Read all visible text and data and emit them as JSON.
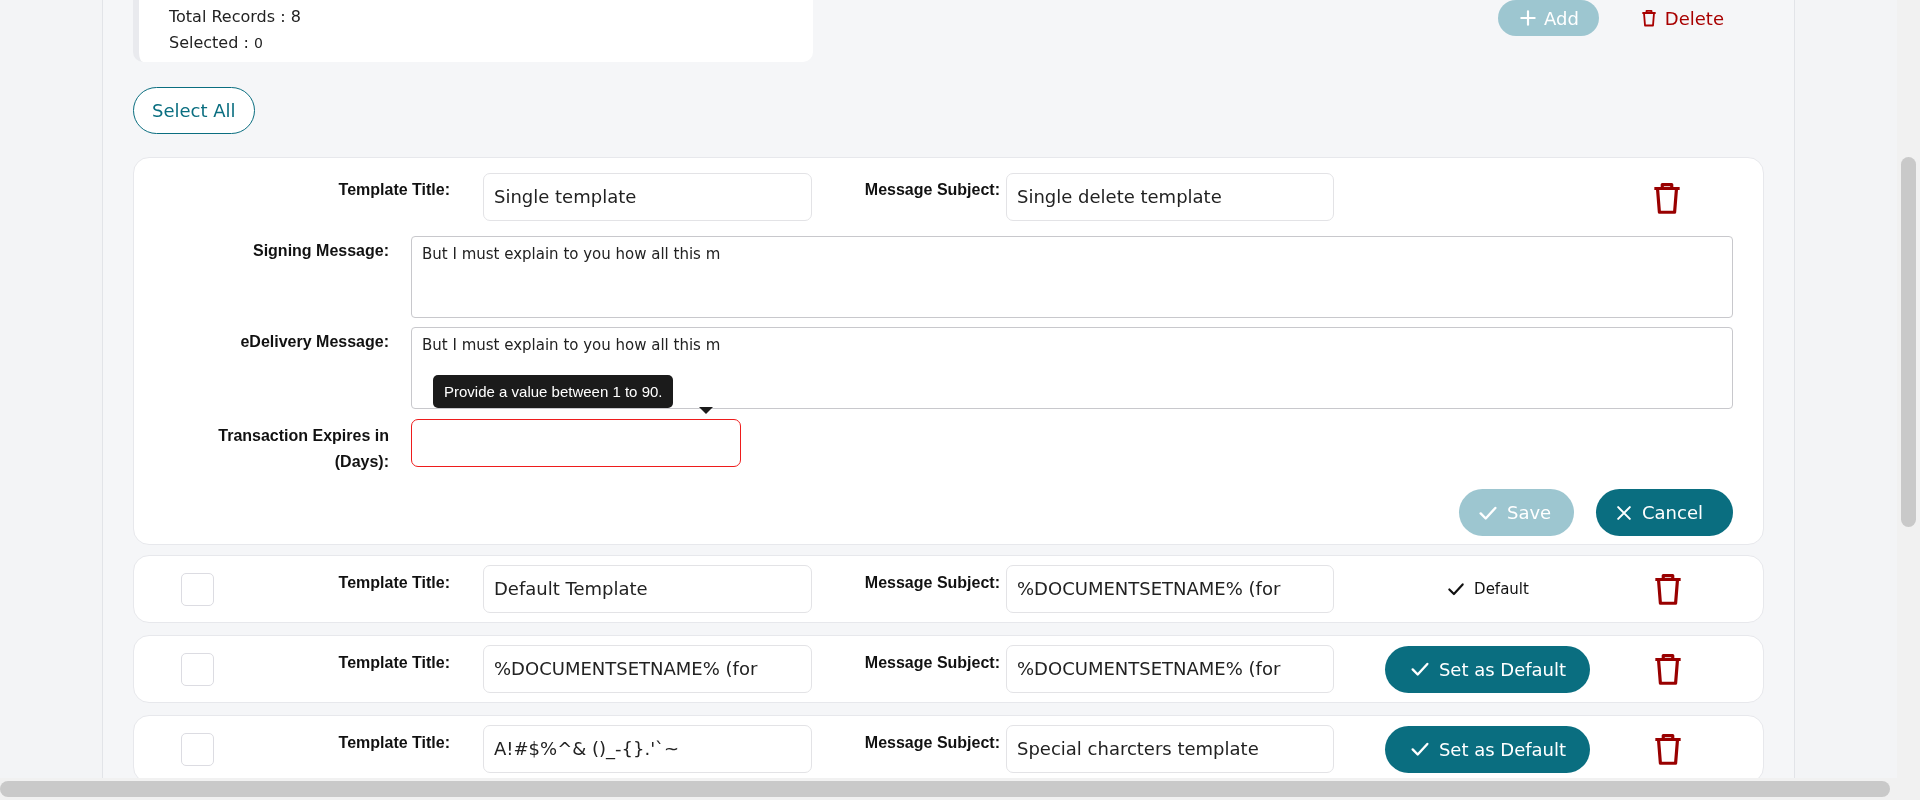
{
  "summary": {
    "total_records": "Total Records : 8",
    "selected_label": "Selected :",
    "selected_count": "0"
  },
  "toolbar": {
    "add": "Add",
    "delete": "Delete"
  },
  "select_all": "Select All",
  "edit_card": {
    "title_label": "Template Title:",
    "title_value": "Single template",
    "subject_label": "Message Subject:",
    "subject_value": "Single delete template",
    "signing_label": "Signing Message:",
    "signing_value": "But I must explain to you how all this m",
    "edelivery_label": "eDelivery Message:",
    "edelivery_value": "But I must explain to you how all this m",
    "expires_label": "Transaction Expires in (Days):",
    "expires_invalid": true,
    "tooltip": "Provide a value between 1 to 90.",
    "save": {
      "label": "Save",
      "disabled": true
    },
    "cancel": "Cancel"
  },
  "templates": [
    {
      "checked": false,
      "title_label": "Template Title:",
      "title_value": "Default Template",
      "subject_label": "Message Subject:",
      "subject_value": "%DOCUMENTSETNAME% (for",
      "is_default": true,
      "default_text": "Default"
    },
    {
      "checked": false,
      "title_label": "Template Title:",
      "title_value": "%DOCUMENTSETNAME% (for",
      "subject_label": "Message Subject:",
      "subject_value": "%DOCUMENTSETNAME% (for",
      "is_default": false,
      "default_text": "Set as Default"
    },
    {
      "checked": false,
      "title_label": "Template Title:",
      "title_value": "A!#$%^& ()_-{}.'`~",
      "subject_label": "Message Subject:",
      "subject_value": "Special charcters template",
      "is_default": false,
      "default_text": "Set as Default"
    }
  ]
}
